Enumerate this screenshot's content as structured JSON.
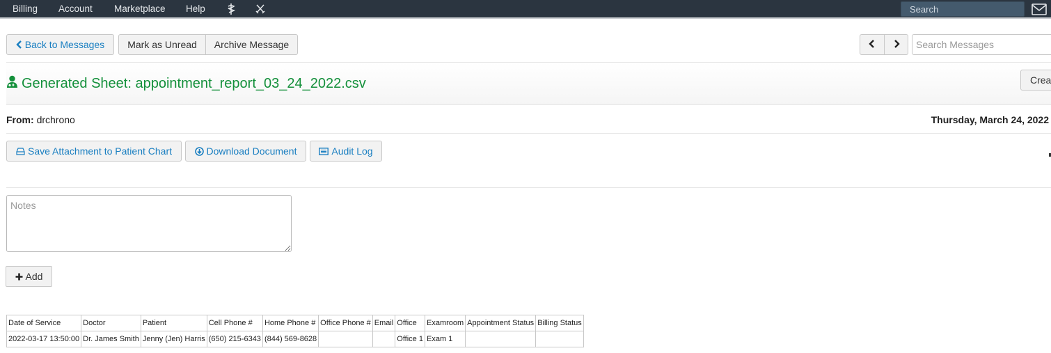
{
  "navbar": {
    "items": [
      "Billing",
      "Account",
      "Marketplace",
      "Help"
    ],
    "icons": [
      "caduceus-icon",
      "crossed-swords-icon"
    ],
    "search_placeholder": "Search",
    "mail_icon": "envelope-icon"
  },
  "toolbar": {
    "back_label": "Back to Messages",
    "mark_unread_label": "Mark as Unread",
    "archive_label": "Archive Message",
    "prev_icon": "chevron-left-icon",
    "next_icon": "chevron-right-icon",
    "search_placeholder": "Search Messages"
  },
  "message": {
    "title": "Generated Sheet: appointment_report_03_24_2022.csv",
    "title_icon": "user-md-icon",
    "create_label": "Creat",
    "from_label": "From:",
    "from_value": "drchrono",
    "date": "Thursday, March 24, 2022",
    "accent_color": "#14903b"
  },
  "actions": {
    "save_attachment_label": "Save Attachment to Patient Chart",
    "download_label": "Download Document",
    "audit_label": "Audit Log",
    "link_color": "#1a7fc1"
  },
  "notes": {
    "placeholder": "Notes",
    "value": "",
    "add_label": "Add"
  },
  "sheet": {
    "headers": [
      "Date of Service",
      "Doctor",
      "Patient",
      "Cell Phone #",
      "Home Phone #",
      "Office Phone #",
      "Email",
      "Office",
      "Examroom",
      "Appointment Status",
      "Billing Status"
    ],
    "rows": [
      [
        "2022-03-17 13:50:00",
        "Dr. James Smith",
        "Jenny (Jen) Harris",
        "(650) 215-6343",
        "(844) 569-8628",
        "",
        "",
        "Office 1",
        "Exam 1",
        "",
        ""
      ]
    ]
  }
}
